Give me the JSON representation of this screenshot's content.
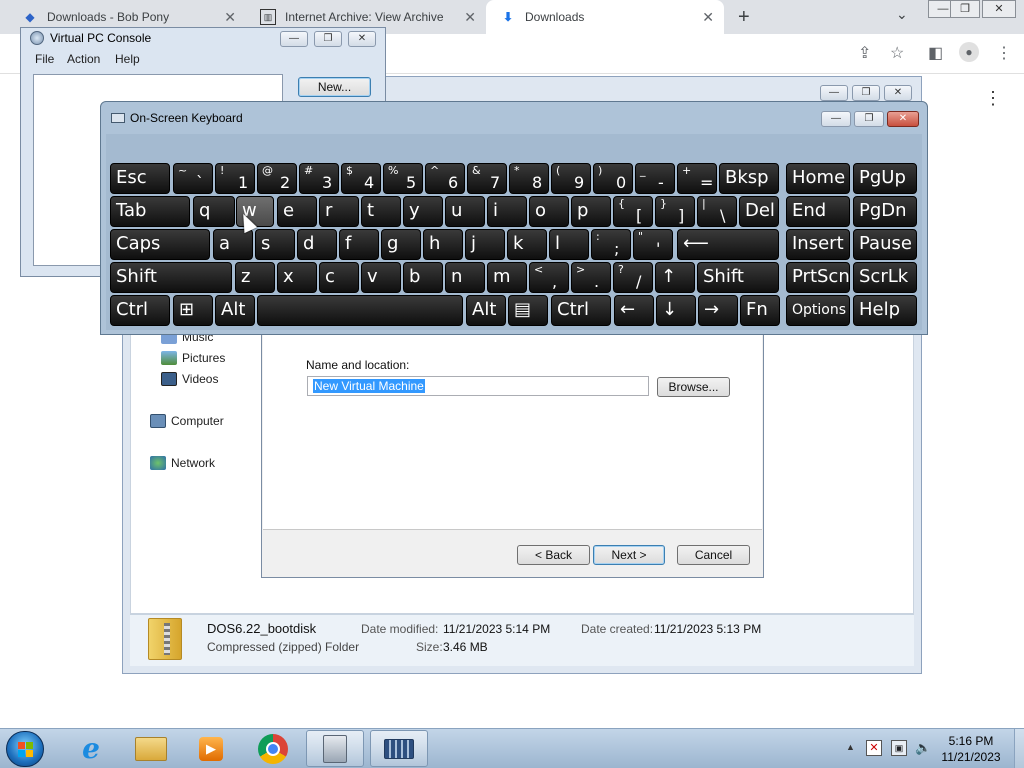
{
  "browser": {
    "tabs": [
      {
        "title": "Downloads - Bob Pony",
        "icon": "bob-pony-icon",
        "active": false
      },
      {
        "title": "Internet Archive: View Archive",
        "icon": "archive-icon",
        "active": false
      },
      {
        "title": "Downloads",
        "icon": "download-icon",
        "active": true
      }
    ],
    "new_tab": "+",
    "tab_menu": "⌄",
    "window_controls": {
      "minimize": "—",
      "maximize": "❐",
      "close": "✕"
    },
    "toolbar_icons": [
      "share-icon",
      "star-icon",
      "sidebar-icon",
      "profile-icon",
      "menu-icon"
    ],
    "page_menu": "⋮"
  },
  "vpc_console": {
    "title": "Virtual PC Console",
    "menu": [
      "File",
      "Action",
      "Help"
    ],
    "new_button": "New..."
  },
  "osk": {
    "title": "On-Screen Keyboard",
    "rows": [
      [
        {
          "label": "Esc"
        },
        {
          "shift": "~",
          "primary": "`"
        },
        {
          "shift": "!",
          "primary": "1"
        },
        {
          "shift": "@",
          "primary": "2"
        },
        {
          "shift": "#",
          "primary": "3"
        },
        {
          "shift": "$",
          "primary": "4"
        },
        {
          "shift": "%",
          "primary": "5"
        },
        {
          "shift": "^",
          "primary": "6"
        },
        {
          "shift": "&",
          "primary": "7"
        },
        {
          "shift": "*",
          "primary": "8"
        },
        {
          "shift": "(",
          "primary": "9"
        },
        {
          "shift": ")",
          "primary": "0"
        },
        {
          "shift": "_",
          "primary": "-"
        },
        {
          "shift": "+",
          "primary": "="
        },
        {
          "label": "Bksp"
        },
        {
          "label": "Home"
        },
        {
          "label": "PgUp"
        }
      ],
      [
        {
          "label": "Tab"
        },
        {
          "label": "q"
        },
        {
          "label": "w"
        },
        {
          "label": "e"
        },
        {
          "label": "r"
        },
        {
          "label": "t"
        },
        {
          "label": "y"
        },
        {
          "label": "u"
        },
        {
          "label": "i"
        },
        {
          "label": "o"
        },
        {
          "label": "p"
        },
        {
          "shift": "{",
          "primary": "["
        },
        {
          "shift": "}",
          "primary": "]"
        },
        {
          "shift": "|",
          "primary": "\\"
        },
        {
          "label": "Del"
        },
        {
          "label": "End"
        },
        {
          "label": "PgDn"
        }
      ],
      [
        {
          "label": "Caps"
        },
        {
          "label": "a"
        },
        {
          "label": "s"
        },
        {
          "label": "d"
        },
        {
          "label": "f"
        },
        {
          "label": "g"
        },
        {
          "label": "h"
        },
        {
          "label": "j"
        },
        {
          "label": "k"
        },
        {
          "label": "l"
        },
        {
          "shift": ":",
          "primary": ";"
        },
        {
          "shift": "\"",
          "primary": "'"
        },
        {
          "label": "⟵"
        },
        {
          "label": "Insert"
        },
        {
          "label": "Pause"
        }
      ],
      [
        {
          "label": "Shift"
        },
        {
          "label": "z"
        },
        {
          "label": "x"
        },
        {
          "label": "c"
        },
        {
          "label": "v"
        },
        {
          "label": "b"
        },
        {
          "label": "n"
        },
        {
          "label": "m"
        },
        {
          "shift": "<",
          "primary": ","
        },
        {
          "shift": ">",
          "primary": "."
        },
        {
          "shift": "?",
          "primary": "/"
        },
        {
          "label": "↑"
        },
        {
          "label": "Shift"
        },
        {
          "label": "PrtScn"
        },
        {
          "label": "ScrLk"
        }
      ],
      [
        {
          "label": "Ctrl"
        },
        {
          "label": "⊞"
        },
        {
          "label": "Alt"
        },
        {
          "label": ""
        },
        {
          "label": "Alt"
        },
        {
          "label": "▤"
        },
        {
          "label": "Ctrl"
        },
        {
          "label": "←"
        },
        {
          "label": "↓"
        },
        {
          "label": "→"
        },
        {
          "label": "Fn"
        },
        {
          "label": "Options"
        },
        {
          "label": "Help"
        }
      ]
    ]
  },
  "explorer": {
    "nav_items": [
      {
        "label": "Music",
        "icon": "music-icon"
      },
      {
        "label": "Pictures",
        "icon": "pictures-icon"
      },
      {
        "label": "Videos",
        "icon": "videos-icon"
      },
      {
        "label": "Computer",
        "icon": "computer-icon"
      },
      {
        "label": "Network",
        "icon": "network-icon"
      }
    ],
    "details": {
      "name": "DOS6.22_bootdisk",
      "type": "Compressed (zipped) Folder",
      "date_modified_label": "Date modified:",
      "date_modified": "11/21/2023 5:14 PM",
      "date_created_label": "Date created:",
      "date_created": "11/21/2023 5:13 PM",
      "size_label": "Size:",
      "size": "3.46 MB"
    }
  },
  "wizard": {
    "name_label": "Name and location:",
    "name_value": "New Virtual Machine",
    "browse": "Browse...",
    "back": "< Back",
    "next": "Next >",
    "cancel": "Cancel"
  },
  "taskbar": {
    "items": [
      "start-orb-icon",
      "internet-explorer-icon",
      "file-explorer-icon",
      "media-player-icon",
      "chrome-icon",
      "virtual-pc-icon",
      "on-screen-keyboard-icon"
    ],
    "time": "5:16 PM",
    "date": "11/21/2023",
    "tray_expand": "▲"
  }
}
